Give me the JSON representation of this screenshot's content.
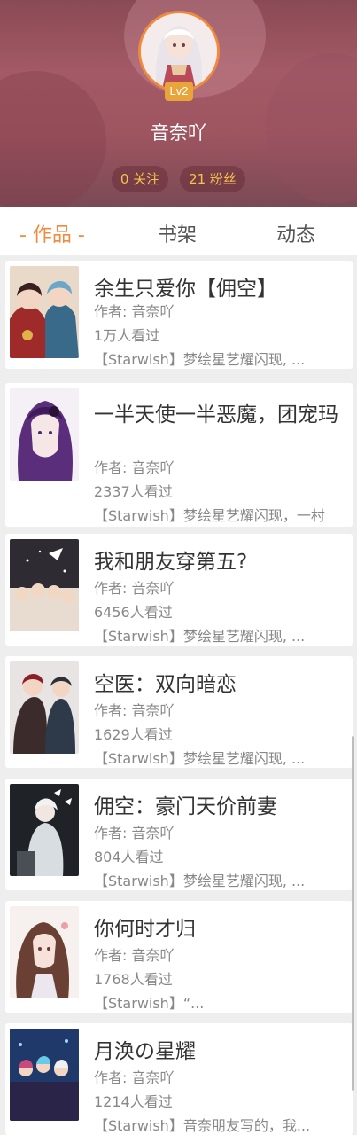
{
  "profile": {
    "level": "Lv2",
    "username": "音奈吖",
    "following": "0 关注",
    "fans": "21 粉丝"
  },
  "tabs": [
    {
      "label": "- 作品 -",
      "active": true
    },
    {
      "label": "书架",
      "active": false
    },
    {
      "label": "动态",
      "active": false
    }
  ],
  "works": [
    {
      "title": "余生只爱你【佣空】",
      "author": "作者: 音奈吖",
      "views": "1万人看过",
      "desc": "【Starwish】梦绘星艺耀闪现, ...",
      "cover": "girl-red-outfit-icon"
    },
    {
      "title": "一半天使一半恶魔，团宠玛",
      "author": "作者: 音奈吖",
      "views": "2337人看过",
      "desc": "【Starwish】梦绘星艺耀闪现，一村",
      "cover": "purple-hair-girl-icon"
    },
    {
      "title": "我和朋友穿第五?",
      "author": "作者: 音奈吖",
      "views": "6456人看过",
      "desc": "【Starwish】梦绘星艺耀闪现, ...",
      "cover": "group-chibi-icon"
    },
    {
      "title": "空医：双向暗恋",
      "author": "作者: 音奈吖",
      "views": "1629人看过",
      "desc": "【Starwish】梦绘星艺耀闪现, ...",
      "cover": "duo-characters-icon"
    },
    {
      "title": "佣空：豪门天价前妻",
      "author": "作者: 音奈吖",
      "views": "804人看过",
      "desc": "【Starwish】梦绘星艺耀闪现, ...",
      "cover": "white-hair-figure-icon"
    },
    {
      "title": "你何时才归",
      "author": "作者: 音奈吖",
      "views": "1768人看过",
      "desc": "【Starwish】“...",
      "cover": "curly-hair-girl-icon"
    },
    {
      "title": "月涣の星耀",
      "author": "作者: 音奈吖",
      "views": "1214人看过",
      "desc": "【Starwish】音奈朋友写的，我...",
      "cover": "blue-group-icon"
    }
  ],
  "colors": {
    "accent": "#f08a3c",
    "badge": "#e9a43a",
    "stat_text": "#f4c34d"
  }
}
